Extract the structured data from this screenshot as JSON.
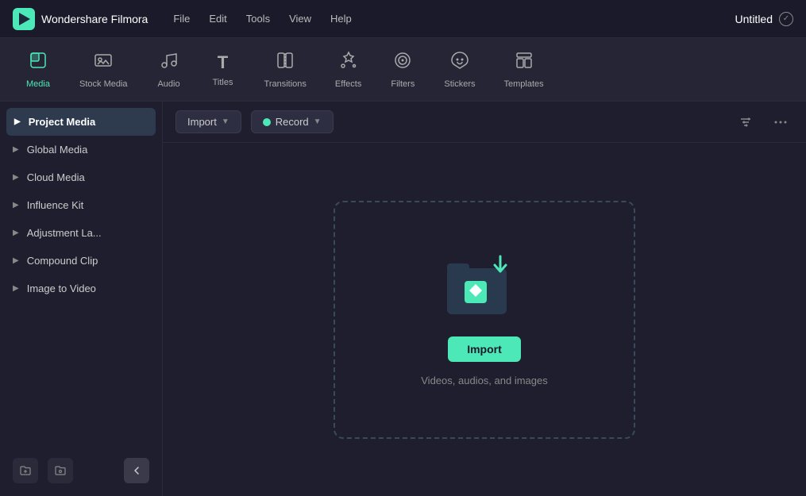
{
  "titlebar": {
    "app_name": "Wondershare Filmora",
    "menu_items": [
      "File",
      "Edit",
      "Tools",
      "View",
      "Help"
    ],
    "project_title": "Untitled"
  },
  "toolbar": {
    "items": [
      {
        "id": "media",
        "label": "Media",
        "icon": "⊞",
        "active": true
      },
      {
        "id": "stock-media",
        "label": "Stock Media",
        "icon": "🖼",
        "active": false
      },
      {
        "id": "audio",
        "label": "Audio",
        "icon": "♪",
        "active": false
      },
      {
        "id": "titles",
        "label": "Titles",
        "icon": "T",
        "active": false
      },
      {
        "id": "transitions",
        "label": "Transitions",
        "icon": "⊡",
        "active": false
      },
      {
        "id": "effects",
        "label": "Effects",
        "icon": "✦",
        "active": false
      },
      {
        "id": "filters",
        "label": "Filters",
        "icon": "◎",
        "active": false
      },
      {
        "id": "stickers",
        "label": "Stickers",
        "icon": "❋",
        "active": false
      },
      {
        "id": "templates",
        "label": "Templates",
        "icon": "⊟",
        "active": false
      }
    ]
  },
  "sidebar": {
    "items": [
      {
        "id": "project-media",
        "label": "Project Media",
        "active": true
      },
      {
        "id": "global-media",
        "label": "Global Media",
        "active": false
      },
      {
        "id": "cloud-media",
        "label": "Cloud Media",
        "active": false
      },
      {
        "id": "influence-kit",
        "label": "Influence Kit",
        "active": false
      },
      {
        "id": "adjustment-la",
        "label": "Adjustment La...",
        "active": false
      },
      {
        "id": "compound-clip",
        "label": "Compound Clip",
        "active": false
      },
      {
        "id": "image-to-video",
        "label": "Image to Video",
        "active": false
      }
    ],
    "new_folder_tooltip": "New Folder",
    "new_smart_collection_tooltip": "New Smart Collection",
    "collapse_tooltip": "Collapse"
  },
  "content_toolbar": {
    "import_label": "Import",
    "record_label": "Record",
    "filter_tooltip": "Filter",
    "more_tooltip": "More options"
  },
  "dropzone": {
    "import_button_label": "Import",
    "description": "Videos, audios, and images"
  }
}
